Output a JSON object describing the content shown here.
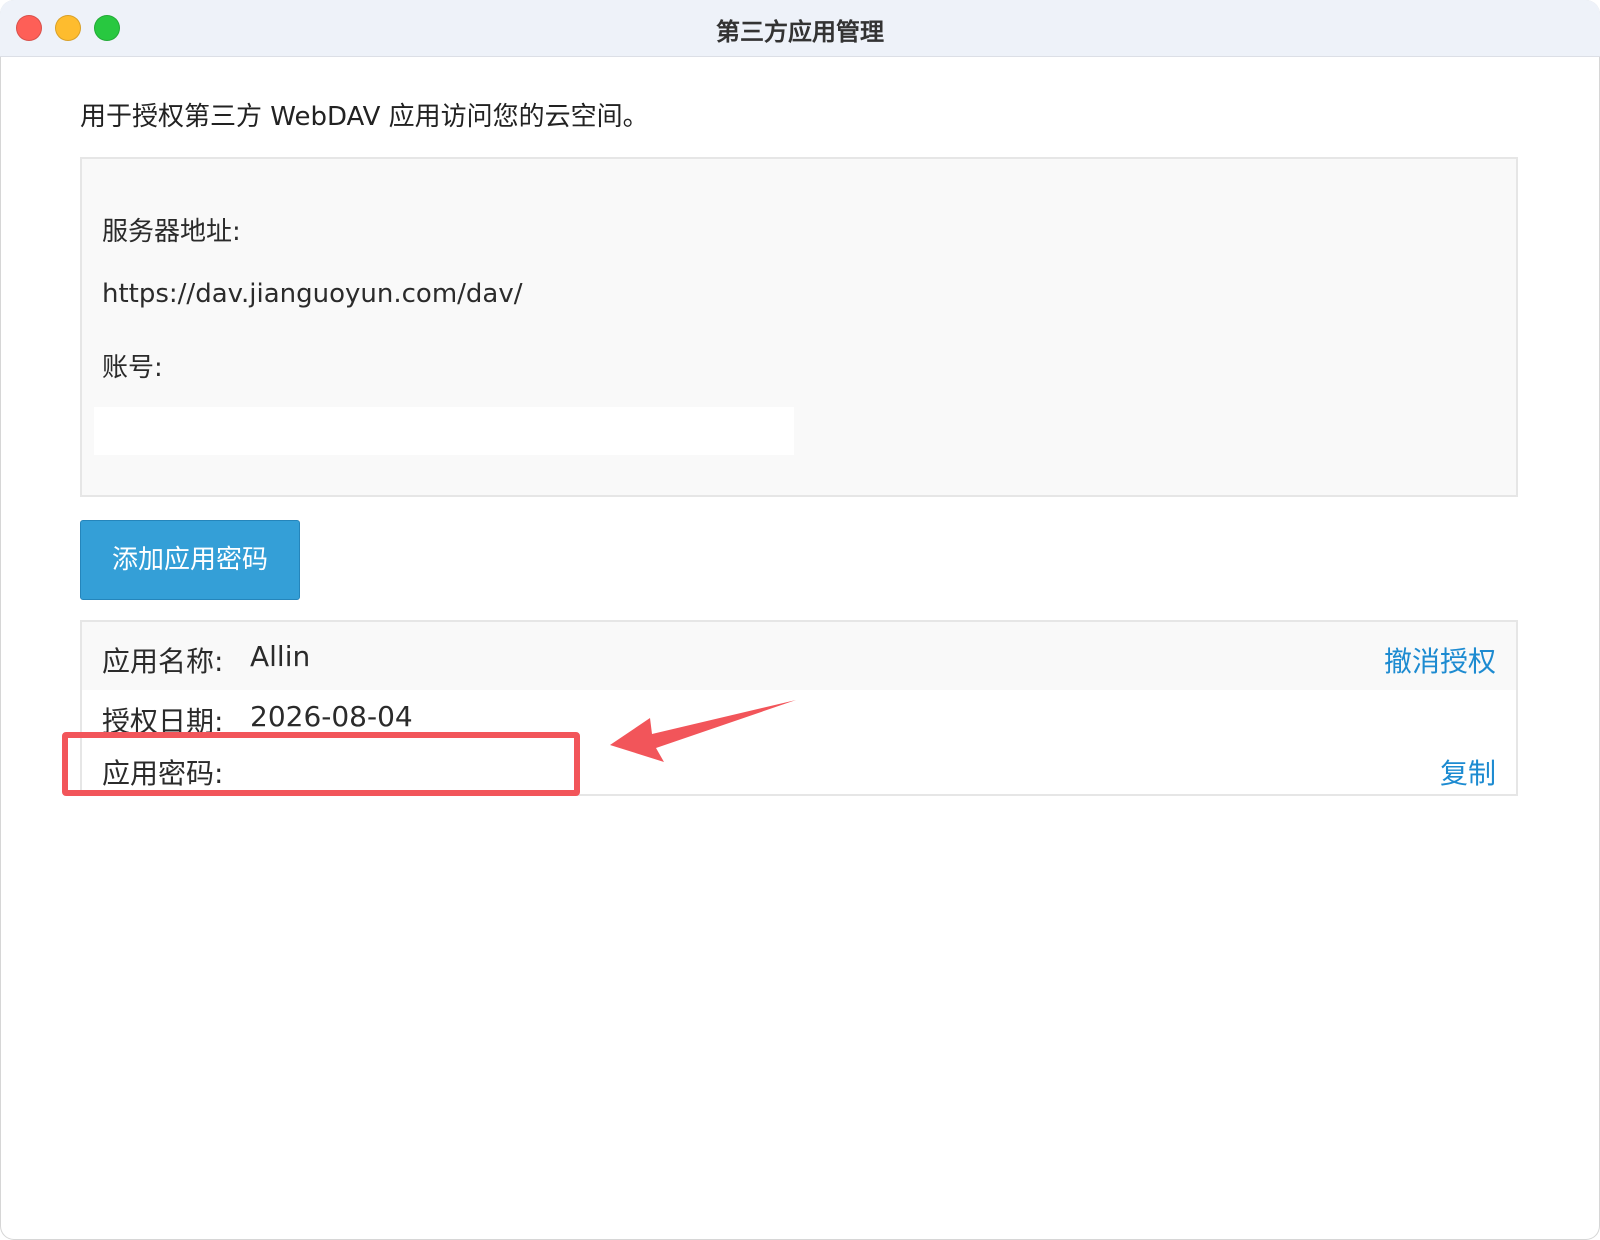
{
  "window": {
    "title": "第三方应用管理"
  },
  "intro_text": "用于授权第三方 WebDAV 应用访问您的云空间。",
  "info_panel": {
    "server_label": "服务器地址:",
    "server_value": "https://dav.jianguoyun.com/dav/",
    "account_label": "账号:"
  },
  "add_button_label": "添加应用密码",
  "app_entry": {
    "name_label": "应用名称:",
    "name_value": "Allin",
    "revoke_label": "撤消授权",
    "date_label": "授权日期:",
    "date_value": "2026-08-04",
    "password_label": "应用密码:",
    "copy_label": "复制"
  },
  "colors": {
    "accent": "#349fd7",
    "link": "#1d8bd1",
    "annotation": "#f2555a"
  },
  "icons": [
    "close-window-icon",
    "minimize-window-icon",
    "zoom-window-icon",
    "annotation-arrow-icon"
  ]
}
